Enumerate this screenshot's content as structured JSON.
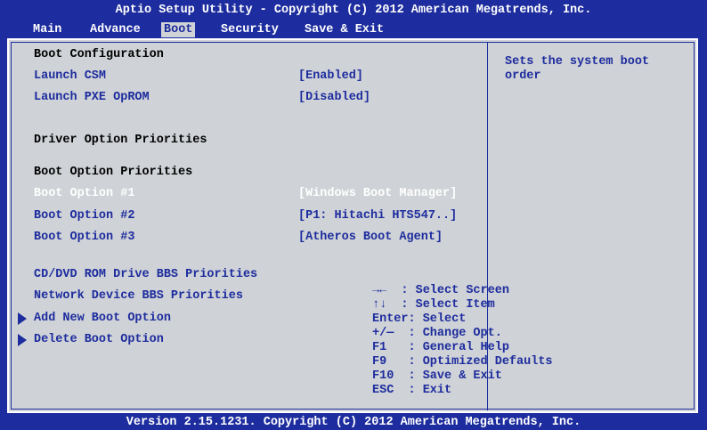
{
  "header": {
    "title": "Aptio Setup Utility - Copyright (C) 2012 American Megatrends, Inc.",
    "menu": [
      "Main",
      "Advance",
      "Boot",
      "Security",
      "Save & Exit"
    ],
    "active_menu": "Boot"
  },
  "boot": {
    "section_boot_configuration": "Boot Configuration",
    "launch_csm_label": "Launch CSM",
    "launch_csm_value": "[Enabled]",
    "launch_pxe_label": "Launch PXE OpROM",
    "launch_pxe_value": "[Disabled]",
    "section_driver_option": "Driver Option Priorities",
    "section_boot_option": "Boot Option Priorities",
    "boot_options": [
      {
        "label": "Boot Option #1",
        "value": "[Windows Boot Manager]",
        "selected": true
      },
      {
        "label": "Boot Option #2",
        "value": "[P1: Hitachi HTS547..]",
        "selected": false
      },
      {
        "label": "Boot Option #3",
        "value": "[Atheros Boot Agent]",
        "selected": false
      }
    ],
    "cd_dvd_priorities": "CD/DVD ROM Drive BBS Priorities",
    "network_priorities": "Network Device BBS Priorities",
    "add_new_boot_option": "Add New Boot Option",
    "delete_boot_option": "Delete Boot Option"
  },
  "help": {
    "description_line1": "Sets the system boot",
    "description_line2": "order",
    "keys": [
      "→←  : Select Screen",
      "↑↓  : Select Item",
      "Enter: Select",
      "+/—  : Change Opt.",
      "F1   : General Help",
      "F9   : Optimized Defaults",
      "F10  : Save & Exit",
      "ESC  : Exit"
    ]
  },
  "footer": "Version 2.15.1231. Copyright (C) 2012 American Megatrends, Inc.",
  "colors": {
    "background": "#1d2c9e",
    "panel": "#cfd2d6",
    "selected_text": "#ffffff"
  }
}
